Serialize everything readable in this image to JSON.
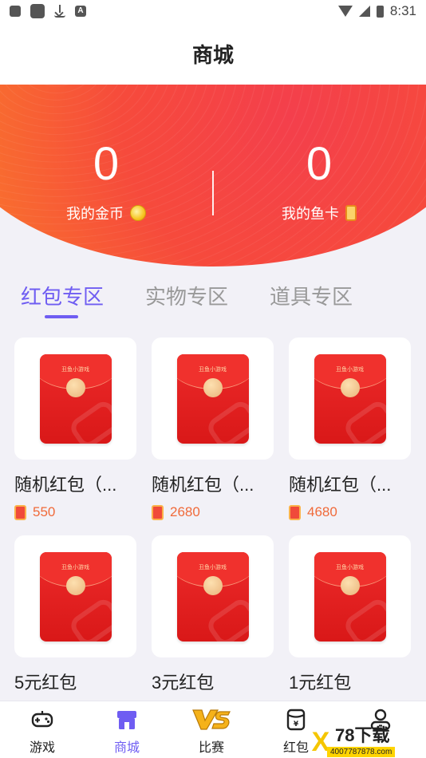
{
  "status_bar": {
    "time": "8:31"
  },
  "header": {
    "title": "商城"
  },
  "wallet": {
    "coins": {
      "value": "0",
      "label": "我的金币"
    },
    "fish_cards": {
      "value": "0",
      "label": "我的鱼卡"
    }
  },
  "tabs": [
    {
      "label": "红包专区",
      "active": true
    },
    {
      "label": "实物专区",
      "active": false
    },
    {
      "label": "道具专区",
      "active": false
    }
  ],
  "envelope_brand": "丑鱼小游戏",
  "products": [
    {
      "name": "随机红包（...",
      "price": "550"
    },
    {
      "name": "随机红包（...",
      "price": "2680"
    },
    {
      "name": "随机红包（...",
      "price": "4680"
    },
    {
      "name": "5元红包",
      "price": ""
    },
    {
      "name": "3元红包",
      "price": ""
    },
    {
      "name": "1元红包",
      "price": ""
    }
  ],
  "bottom_nav": [
    {
      "label": "游戏",
      "icon": "gamepad-icon",
      "active": false
    },
    {
      "label": "商城",
      "icon": "store-icon",
      "active": true
    },
    {
      "label": "比赛",
      "icon": "vs-icon",
      "active": false
    },
    {
      "label": "红包",
      "icon": "wallet-icon",
      "active": false
    },
    {
      "label": "",
      "icon": "profile-icon",
      "active": false
    }
  ],
  "watermark": {
    "title": "78下载",
    "url": "4007787878.com"
  },
  "colors": {
    "accent": "#6f5df2",
    "banner_orange": "#fa7a2a",
    "banner_red": "#f43f4c",
    "price": "#f06a3a"
  }
}
